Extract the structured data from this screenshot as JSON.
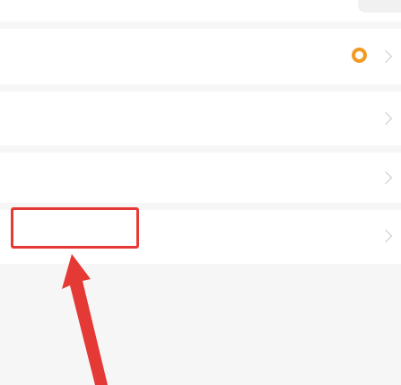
{
  "top_partial": {
    "label": ""
  },
  "settings": {
    "rows": [
      {
        "label": "",
        "value": "",
        "has_status_dot": true,
        "status_color": "#f39a26"
      },
      {
        "label": "",
        "value": ""
      },
      {
        "label": "",
        "value": ""
      },
      {
        "label": "",
        "value": ""
      }
    ]
  },
  "annotation": {
    "box_color": "#e53935",
    "arrow_color": "#e53935"
  }
}
